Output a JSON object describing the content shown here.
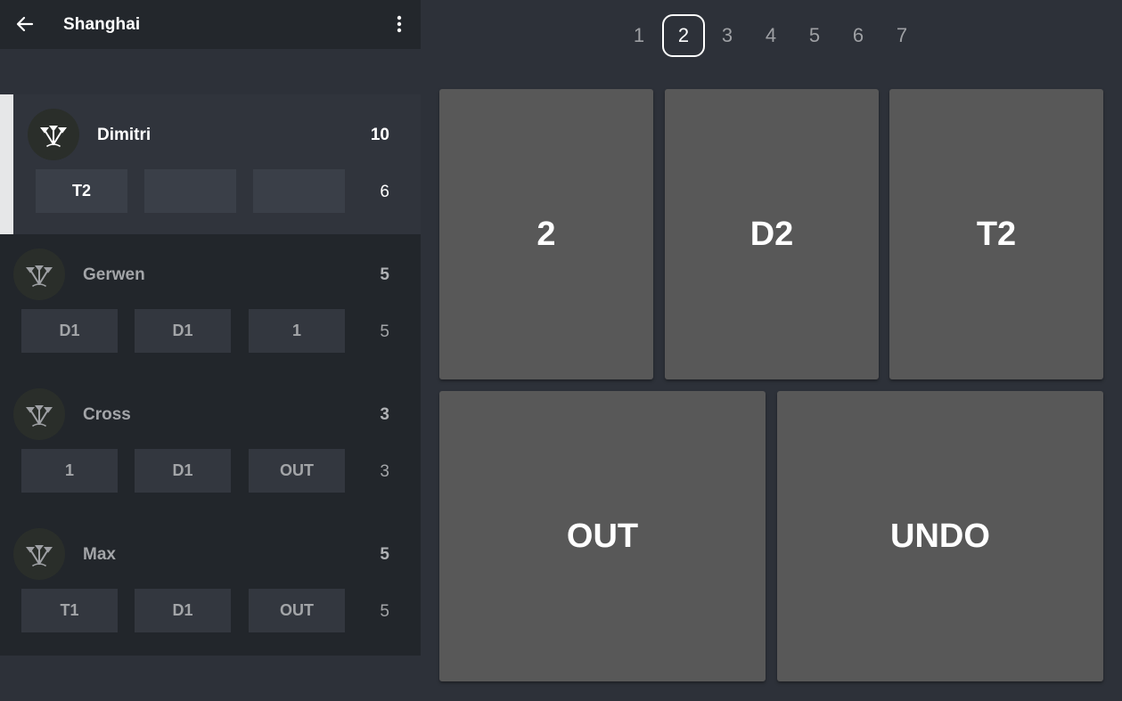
{
  "header": {
    "title": "Shanghai",
    "back_icon": "arrow-left-icon",
    "menu_icon": "more-vertical-icon"
  },
  "players": [
    {
      "name": "Dimitri",
      "score": "10",
      "darts": [
        "T2",
        "",
        ""
      ],
      "round_score": "6",
      "active": true
    },
    {
      "name": "Gerwen",
      "score": "5",
      "darts": [
        "D1",
        "D1",
        "1"
      ],
      "round_score": "5",
      "active": false
    },
    {
      "name": "Cross",
      "score": "3",
      "darts": [
        "1",
        "D1",
        "OUT"
      ],
      "round_score": "3",
      "active": false
    },
    {
      "name": "Max",
      "score": "5",
      "darts": [
        "T1",
        "D1",
        "OUT"
      ],
      "round_score": "5",
      "active": false
    }
  ],
  "rounds": {
    "items": [
      "1",
      "2",
      "3",
      "4",
      "5",
      "6",
      "7"
    ],
    "selected": "2"
  },
  "keypad": {
    "single": "2",
    "double": "D2",
    "triple": "T2",
    "out": "OUT",
    "undo": "UNDO"
  },
  "colors": {
    "accent": "#ffffff",
    "key_bg": "#585858",
    "panel_bg": "#22262b",
    "active_bg": "#30343c"
  }
}
